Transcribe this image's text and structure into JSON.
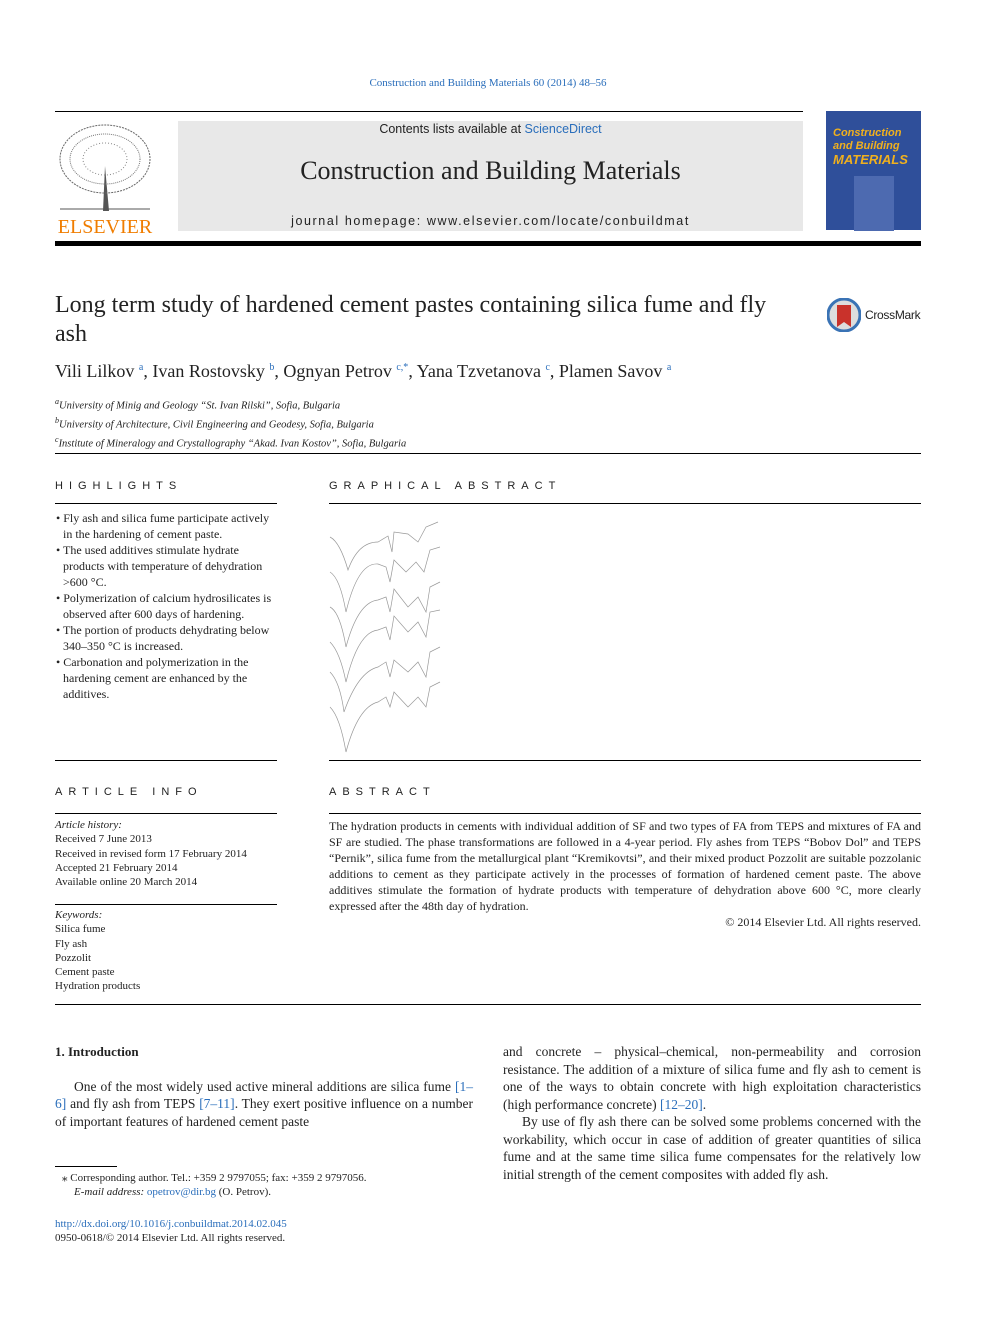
{
  "journal_ref": "Construction and Building Materials 60 (2014) 48–56",
  "header": {
    "contents_prefix": "Contents lists available at ",
    "sciencedirect": "ScienceDirect",
    "journal_title": "Construction and Building Materials",
    "homepage": "journal homepage: www.elsevier.com/locate/conbuildmat",
    "publisher_logo": "ELSEVIER",
    "cover_title": [
      "Construction",
      "and Building",
      "MATERIALS"
    ]
  },
  "article": {
    "title": "Long term study of hardened cement pastes containing silica fume and fly ash",
    "crossmark": "CrossMark",
    "authors": [
      {
        "name": "Vili Lilkov",
        "sup": "a"
      },
      {
        "name": "Ivan Rostovsky",
        "sup": "b"
      },
      {
        "name": "Ognyan Petrov",
        "sup": "c,*"
      },
      {
        "name": "Yana Tzvetanova",
        "sup": "c"
      },
      {
        "name": "Plamen Savov",
        "sup": "a"
      }
    ],
    "affiliations": [
      {
        "sup": "a",
        "text": "University of Minig and Geology “St. Ivan Rilski”, Sofia, Bulgaria"
      },
      {
        "sup": "b",
        "text": "University of Architecture, Civil Engineering and Geodesy, Sofia, Bulgaria"
      },
      {
        "sup": "c",
        "text": "Institute of Mineralogy and Crystallography “Akad. Ivan Kostov”, Sofia, Bulgaria"
      }
    ]
  },
  "highlights": {
    "heading": "HIGHLIGHTS",
    "items": [
      "Fly ash and silica fume participate actively in the hardening of cement paste.",
      "The used additives stimulate hydrate products with temperature of dehydration >600 °C.",
      "Polymerization of calcium hydrosilicates is observed after 600 days of hardening.",
      "The portion of products dehydrating below 340–350 °C is increased.",
      "Carbonation and polymerization in the hardening cement are enhanced by the additives."
    ]
  },
  "graphical_abstract": {
    "heading": "GRAPHICAL ABSTRACT"
  },
  "article_info": {
    "heading": "ARTICLE INFO",
    "history_label": "Article history:",
    "history": [
      "Received 7 June 2013",
      "Received in revised form 17 February 2014",
      "Accepted 21 February 2014",
      "Available online 20 March 2014"
    ],
    "keywords_label": "Keywords:",
    "keywords": [
      "Silica fume",
      "Fly ash",
      "Pozzolit",
      "Cement paste",
      "Hydration products"
    ]
  },
  "abstract": {
    "heading": "ABSTRACT",
    "text": "The hydration products in cements with individual addition of SF and two types of FA from TEPS and mixtures of FA and SF are studied. The phase transformations are followed in a 4-year period. Fly ashes from TEPS “Bobov Dol” and TEPS “Pernik”, silica fume from the metallurgical plant “Kremikovtsi”, and their mixed product Pozzolit are suitable pozzolanic additions to cement as they participate actively in the processes of formation of hardened cement paste. The above additives stimulate the formation of hydrate products with temperature of dehydration above 600 °C, more clearly expressed after the 48th day of hydration.",
    "copyright": "© 2014 Elsevier Ltd. All rights reserved."
  },
  "intro": {
    "heading": "1. Introduction",
    "p1_a": "One of the most widely used active mineral additions are silica fume ",
    "ref1": "[1–6]",
    "p1_b": " and fly ash from TEPS ",
    "ref2": "[7–11]",
    "p1_c": ". They exert positive influence on a number of important features of hardened cement paste",
    "p2_a": "and concrete – physical–chemical, non-permeability and corrosion resistance. The addition of a mixture of silica fume and fly ash to cement is one of the ways to obtain concrete with high exploitation characteristics (high performance concrete) ",
    "ref3": "[12–20]",
    "p2_b": ".",
    "p3": "By use of fly ash there can be solved some problems concerned with the workability, which occur in case of addition of greater quantities of silica fume and at the same time silica fume compensates for the relatively low initial strength of the cement composites with added fly ash."
  },
  "footnote": {
    "star": "⁎",
    "text": "Corresponding author. Tel.: +359 2 9797055; fax: +359 2 9797056.",
    "email_label": "E-mail address: ",
    "email": "opetrov@dir.bg",
    "email_suffix": " (O. Petrov)."
  },
  "doi": "http://dx.doi.org/10.1016/j.conbuildmat.2014.02.045",
  "issn": "0950-0618/© 2014 Elsevier Ltd. All rights reserved."
}
